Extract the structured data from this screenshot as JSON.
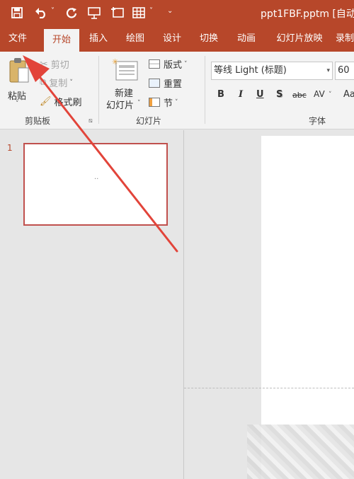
{
  "title_bar": {
    "doc_title": "ppt1FBF.pptm [自动",
    "qat": [
      "save-icon",
      "undo-icon",
      "redo-icon",
      "present-icon",
      "new-slide-icon",
      "table-icon",
      "customize-icon"
    ]
  },
  "tabs": [
    "文件",
    "开始",
    "插入",
    "绘图",
    "设计",
    "切换",
    "动画",
    "幻灯片放映",
    "录制"
  ],
  "ribbon": {
    "clipboard": {
      "paste_label": "粘贴",
      "cut_label": "剪切",
      "copy_label": "复制",
      "format_painter_label": "格式刷",
      "group_label": "剪贴板"
    },
    "slides": {
      "new_slide_line1": "新建",
      "new_slide_line2": "幻灯片",
      "layout_label": "版式",
      "reset_label": "重置",
      "section_label": "节",
      "group_label": "幻灯片"
    },
    "font": {
      "font_name": "等线 Light (标题)",
      "font_size": "60",
      "bold": "B",
      "italic": "I",
      "underline": "U",
      "shadow": "S",
      "strikethrough": "abc",
      "spacing": "AV",
      "case": "Aa",
      "group_label": "字体"
    }
  },
  "thumbnails": {
    "slide_number": "1"
  },
  "colors": {
    "accent": "#b7472a",
    "arrow": "#e2443a",
    "thumb_border": "#c0504d"
  }
}
